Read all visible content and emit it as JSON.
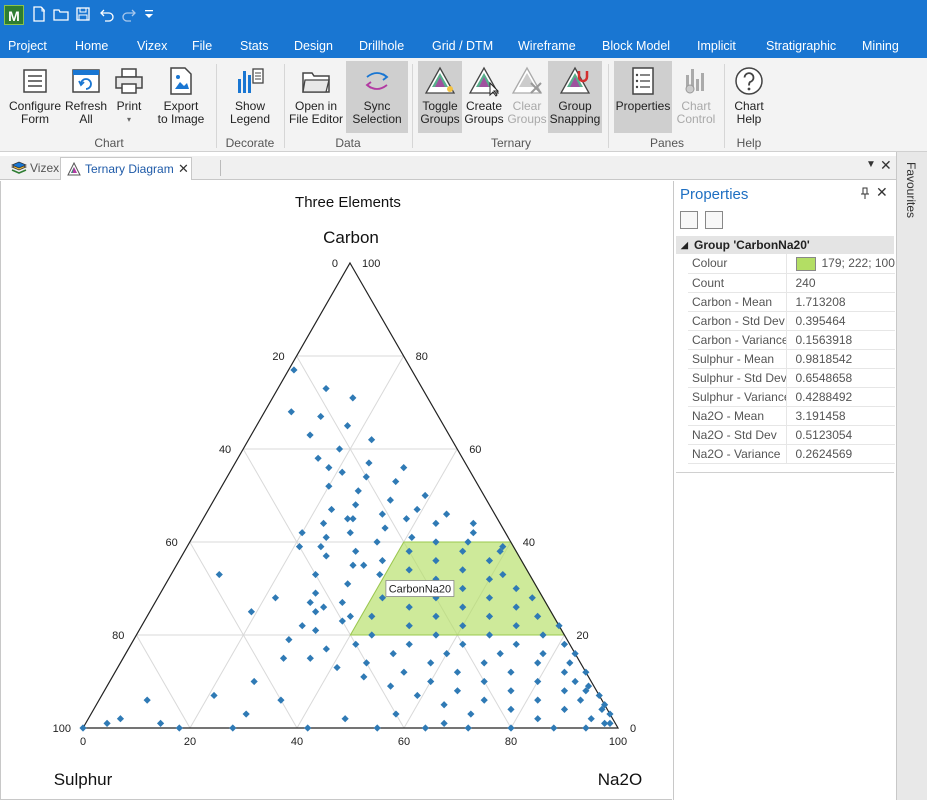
{
  "quick_access": {
    "app_logo": "M",
    "icons": [
      "new-icon",
      "open-icon",
      "save-icon",
      "undo-icon",
      "redo-icon",
      "customize-icon"
    ]
  },
  "menu": {
    "items": [
      "Project",
      "Home",
      "Vizex",
      "File",
      "Stats",
      "Design",
      "Drillhole",
      "Grid / DTM",
      "Wireframe",
      "Block Model",
      "Implicit",
      "Stratigraphic",
      "Mining"
    ]
  },
  "ribbon": {
    "groups": {
      "chart": "Chart",
      "decorate": "Decorate",
      "data": "Data",
      "ternary": "Ternary",
      "panes": "Panes",
      "help": "Help"
    },
    "buttons": {
      "configure_form": "Configure\nForm",
      "refresh_all": "Refresh\nAll",
      "print": "Print",
      "export_to_image": "Export\nto Image",
      "show_legend": "Show\nLegend",
      "open_in_file_editor": "Open in\nFile Editor",
      "sync_selection": "Sync\nSelection",
      "toggle_groups": "Toggle\nGroups",
      "create_groups": "Create\nGroups",
      "clear_groups": "Clear\nGroups",
      "group_snapping": "Group\nSnapping",
      "properties": "Properties",
      "chart_control": "Chart\nControl",
      "chart_help": "Chart\nHelp"
    }
  },
  "doc_tabs": [
    {
      "label": "Vizex",
      "active": false
    },
    {
      "label": "Ternary Diagram",
      "active": true
    }
  ],
  "chart_data": {
    "type": "scatter",
    "subtype": "ternary",
    "title": "Three Elements",
    "axes": {
      "top": "Carbon",
      "left": "Sulphur",
      "right": "Na2O"
    },
    "ticks": [
      0,
      20,
      40,
      60,
      80,
      100
    ],
    "grid": true,
    "point_color": "#2f7ab5",
    "group_region": {
      "name": "CarbonNa20",
      "color": "#b3de64",
      "carbon_range": [
        20,
        40
      ],
      "vertices_sulphur_carbon_na2o": [
        [
          20,
          40,
          40
        ],
        [
          0,
          40,
          60
        ],
        [
          0,
          20,
          80
        ],
        [
          40,
          20,
          40
        ]
      ]
    },
    "series": [
      {
        "name": "",
        "points_sulphur_carbon_na2o": [
          [
            22,
            77,
            1
          ],
          [
            18,
            73,
            9
          ],
          [
            14,
            71,
            15
          ],
          [
            27,
            68,
            5
          ],
          [
            22,
            67,
            11
          ],
          [
            18,
            65,
            17
          ],
          [
            26,
            63,
            11
          ],
          [
            15,
            62,
            23
          ],
          [
            22,
            60,
            18
          ],
          [
            27,
            58,
            15
          ],
          [
            18,
            57,
            25
          ],
          [
            12,
            56,
            32
          ],
          [
            24,
            55,
            21
          ],
          [
            20,
            54,
            26
          ],
          [
            15,
            53,
            32
          ],
          [
            28,
            52,
            20
          ],
          [
            23,
            51,
            26
          ],
          [
            11,
            50,
            39
          ],
          [
            18,
            49,
            33
          ],
          [
            25,
            48,
            27
          ],
          [
            30,
            47,
            23
          ],
          [
            14,
            47,
            39
          ],
          [
            21,
            46,
            33
          ],
          [
            9,
            46,
            45
          ],
          [
            27,
            45,
            28
          ],
          [
            17,
            45,
            38
          ],
          [
            33,
            44,
            23
          ],
          [
            12,
            44,
            44
          ],
          [
            22,
            43,
            35
          ],
          [
            29,
            42,
            29
          ],
          [
            38,
            42,
            20
          ],
          [
            6,
            42,
            52
          ],
          [
            18,
            41,
            41
          ],
          [
            34,
            41,
            25
          ],
          [
            25,
            40,
            35
          ],
          [
            14,
            40,
            46
          ],
          [
            40,
            39,
            21
          ],
          [
            30,
            38,
            32
          ],
          [
            20,
            38,
            42
          ],
          [
            10,
            38,
            52
          ],
          [
            36,
            37,
            27
          ],
          [
            26,
            36,
            38
          ],
          [
            16,
            36,
            48
          ],
          [
            6,
            36,
            58
          ],
          [
            32,
            35,
            33
          ],
          [
            22,
            34,
            44
          ],
          [
            12,
            34,
            54
          ],
          [
            40,
            33,
            27
          ],
          [
            28,
            33,
            39
          ],
          [
            18,
            32,
            50
          ],
          [
            8,
            32,
            60
          ],
          [
            35,
            31,
            34
          ],
          [
            24,
            30,
            46
          ],
          [
            14,
            30,
            56
          ],
          [
            4,
            30,
            66
          ],
          [
            42,
            29,
            29
          ],
          [
            30,
            28,
            42
          ],
          [
            20,
            28,
            52
          ],
          [
            10,
            28,
            62
          ],
          [
            38,
            27,
            35
          ],
          [
            26,
            26,
            48
          ],
          [
            16,
            26,
            58
          ],
          [
            6,
            26,
            68
          ],
          [
            44,
            25,
            31
          ],
          [
            34,
            24,
            42
          ],
          [
            22,
            24,
            54
          ],
          [
            12,
            24,
            64
          ],
          [
            40,
            23,
            37
          ],
          [
            28,
            22,
            50
          ],
          [
            18,
            22,
            60
          ],
          [
            8,
            22,
            70
          ],
          [
            46,
            21,
            33
          ],
          [
            36,
            20,
            44
          ],
          [
            24,
            20,
            56
          ],
          [
            14,
            20,
            66
          ],
          [
            4,
            20,
            76
          ],
          [
            52,
            19,
            29
          ],
          [
            40,
            18,
            42
          ],
          [
            30,
            18,
            52
          ],
          [
            20,
            18,
            62
          ],
          [
            10,
            18,
            72
          ],
          [
            46,
            17,
            37
          ],
          [
            34,
            16,
            50
          ],
          [
            24,
            16,
            60
          ],
          [
            14,
            16,
            70
          ],
          [
            6,
            16,
            78
          ],
          [
            50,
            15,
            35
          ],
          [
            40,
            14,
            46
          ],
          [
            28,
            14,
            58
          ],
          [
            18,
            14,
            68
          ],
          [
            8,
            14,
            78
          ],
          [
            46,
            13,
            41
          ],
          [
            34,
            12,
            54
          ],
          [
            24,
            12,
            64
          ],
          [
            14,
            12,
            74
          ],
          [
            4,
            12,
            84
          ],
          [
            42,
            11,
            47
          ],
          [
            30,
            10,
            60
          ],
          [
            20,
            10,
            70
          ],
          [
            10,
            10,
            80
          ],
          [
            3,
            10,
            87
          ],
          [
            38,
            9,
            53
          ],
          [
            26,
            8,
            66
          ],
          [
            16,
            8,
            76
          ],
          [
            6,
            8,
            86
          ],
          [
            2,
            8,
            90
          ],
          [
            34,
            7,
            59
          ],
          [
            22,
            6,
            72
          ],
          [
            12,
            6,
            82
          ],
          [
            4,
            6,
            90
          ],
          [
            30,
            5,
            65
          ],
          [
            18,
            4,
            78
          ],
          [
            8,
            4,
            88
          ],
          [
            1,
            4,
            95
          ],
          [
            26,
            3,
            71
          ],
          [
            14,
            2,
            84
          ],
          [
            4,
            2,
            94
          ],
          [
            2,
            1,
            97
          ],
          [
            1,
            1,
            98
          ],
          [
            0,
            3,
            97
          ],
          [
            0,
            5,
            95
          ],
          [
            0,
            7,
            93
          ],
          [
            1,
            9,
            90
          ],
          [
            0,
            12,
            88
          ],
          [
            2,
            14,
            84
          ],
          [
            0,
            16,
            84
          ],
          [
            1,
            18,
            81
          ],
          [
            0,
            22,
            78
          ],
          [
            3,
            24,
            73
          ],
          [
            2,
            28,
            70
          ],
          [
            5,
            33,
            62
          ],
          [
            3,
            38,
            59
          ],
          [
            8,
            40,
            52
          ],
          [
            5,
            44,
            51
          ],
          [
            2,
            39,
            59
          ],
          [
            58,
            33,
            9
          ],
          [
            56,
            25,
            19
          ],
          [
            55,
            15,
            30
          ],
          [
            63,
            10,
            27
          ],
          [
            72,
            7,
            21
          ],
          [
            60,
            6,
            34
          ],
          [
            85,
            6,
            9
          ],
          [
            92,
            2,
            6
          ],
          [
            85,
            1,
            14
          ],
          [
            82,
            0,
            18
          ],
          [
            72,
            0,
            28
          ],
          [
            58,
            0,
            42
          ],
          [
            45,
            0,
            55
          ],
          [
            36,
            0,
            64
          ],
          [
            28,
            0,
            72
          ],
          [
            20,
            0,
            80
          ],
          [
            12,
            0,
            88
          ],
          [
            6,
            0,
            94
          ],
          [
            100,
            0,
            0
          ],
          [
            95,
            1,
            4
          ],
          [
            50,
            2,
            48
          ],
          [
            40,
            3,
            57
          ],
          [
            32,
            1,
            67
          ],
          [
            68,
            3,
            29
          ],
          [
            48,
            22,
            30
          ],
          [
            44,
            27,
            29
          ],
          [
            38,
            24,
            38
          ],
          [
            42,
            26,
            32
          ],
          [
            50,
            28,
            22
          ],
          [
            30,
            35,
            35
          ],
          [
            36,
            39,
            25
          ],
          [
            28,
            45,
            27
          ],
          [
            26,
            56,
            18
          ]
        ]
      }
    ],
    "tooltip_label": "CarbonNa20"
  },
  "properties": {
    "title": "Properties",
    "group_header": "Group 'CarbonNa20'",
    "rows": [
      {
        "name": "Colour",
        "value": "179; 222; 100",
        "swatch": "#b3de64"
      },
      {
        "name": "Count",
        "value": "240"
      },
      {
        "name": "Carbon - Mean",
        "value": "1.713208"
      },
      {
        "name": "Carbon - Std Dev",
        "value": "0.395464"
      },
      {
        "name": "Carbon - Variance",
        "value": "0.1563918"
      },
      {
        "name": "Sulphur - Mean",
        "value": "0.9818542"
      },
      {
        "name": "Sulphur - Std Dev",
        "value": "0.6548658"
      },
      {
        "name": "Sulphur - Variance",
        "value": "0.4288492"
      },
      {
        "name": "Na2O - Mean",
        "value": "3.191458"
      },
      {
        "name": "Na2O - Std Dev",
        "value": "0.5123054"
      },
      {
        "name": "Na2O - Variance",
        "value": "0.2624569"
      }
    ]
  },
  "favourites": {
    "label": "Favourites"
  }
}
